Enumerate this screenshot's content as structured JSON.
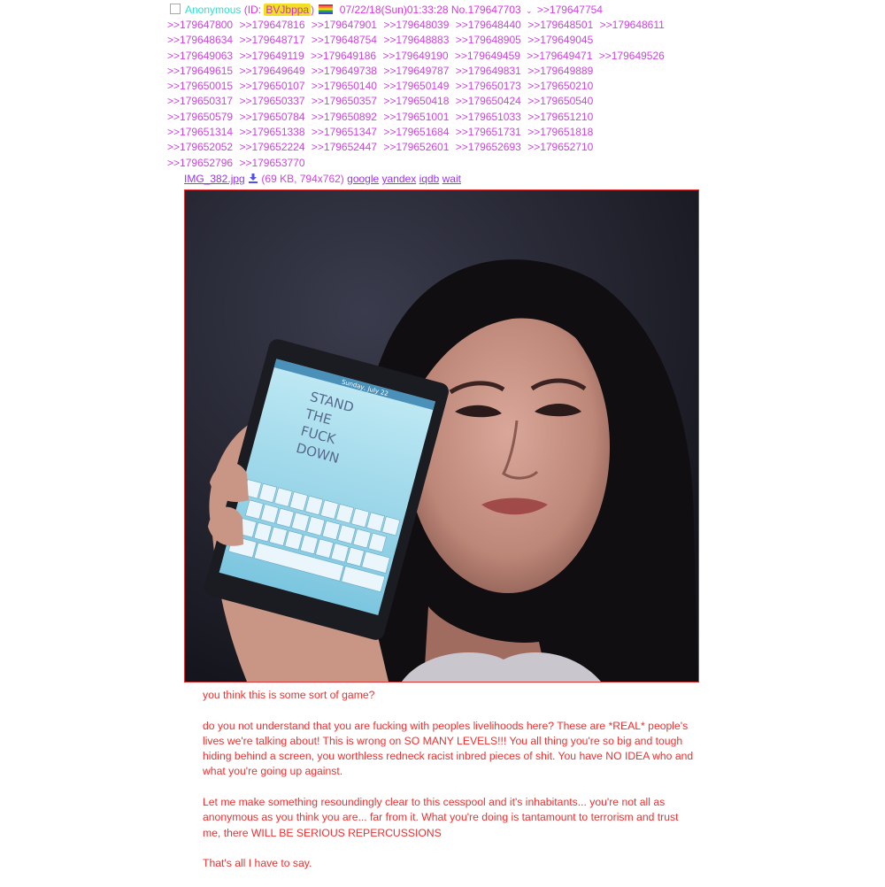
{
  "post": {
    "name": "Anonymous",
    "id_prefix": "(ID:",
    "id": "BVJbppa",
    "id_suffix": ")",
    "datetime": "07/22/18(Sun)01:33:28",
    "post_number": "No.179647703",
    "dropdown_glyph": "⌄",
    "first_backlink": ">>179647754",
    "backlinks": [
      ">>179647800",
      ">>179647816",
      ">>179647901",
      ">>179648039",
      ">>179648440",
      ">>179648501",
      ">>179648611",
      ">>179648634",
      ">>179648717",
      ">>179648754",
      ">>179648883",
      ">>179648905",
      ">>179649045",
      ">>179649063",
      ">>179649119",
      ">>179649186",
      ">>179649190",
      ">>179649459",
      ">>179649471",
      ">>179649526",
      ">>179649615",
      ">>179649649",
      ">>179649738",
      ">>179649787",
      ">>179649831",
      ">>179649889",
      ">>179650015",
      ">>179650107",
      ">>179650140",
      ">>179650149",
      ">>179650173",
      ">>179650210",
      ">>179650317",
      ">>179650337",
      ">>179650357",
      ">>179650418",
      ">>179650424",
      ">>179650540",
      ">>179650579",
      ">>179650784",
      ">>179650892",
      ">>179651001",
      ">>179651033",
      ">>179651210",
      ">>179651314",
      ">>179651338",
      ">>179651347",
      ">>179651684",
      ">>179651731",
      ">>179651818",
      ">>179652052",
      ">>179652224",
      ">>179652447",
      ">>179652601",
      ">>179652693",
      ">>179652710",
      ">>179652796",
      ">>179653770"
    ],
    "backlink_rows": [
      7,
      6,
      7,
      6,
      6,
      6,
      6,
      6,
      6,
      2
    ],
    "file": {
      "filename": "IMG_382.jpg",
      "size_info": "(69 KB, 794x762)",
      "search_links": [
        "google",
        "yandex",
        "iqdb",
        "wait"
      ]
    },
    "image": {
      "phone_text": [
        "STAND",
        "THE",
        "FUCK",
        "DOWN"
      ],
      "phone_status": "Sunday, July 22"
    },
    "body": [
      "you think this is some sort of game?",
      "do you not understand that you are fucking with peoples livelihoods here? These are *REAL* people's lives we're talking about! This is wrong on SO MANY LEVELS!!! You all thing you're so big and tough hiding behind a screen, you worthless redneck racist inbred pieces of shit. You have NO IDEA who and what you're going up against.",
      "Let me make something resoundingly clear to this cesspool and it's inhabitants... you're not all as anonymous as you think you are... far from it. What you're doing is tantamount to terrorism and trust me, there WILL BE SERIOUS REPERCUSSIONS",
      "That's all I have to say."
    ]
  },
  "colors": {
    "name": "#33ddcc",
    "meta": "#dd33dd",
    "backlink": "#cc44dd",
    "body_text": "#ee3030",
    "image_border": "#dd3333",
    "id_highlight": "#f0e020"
  }
}
